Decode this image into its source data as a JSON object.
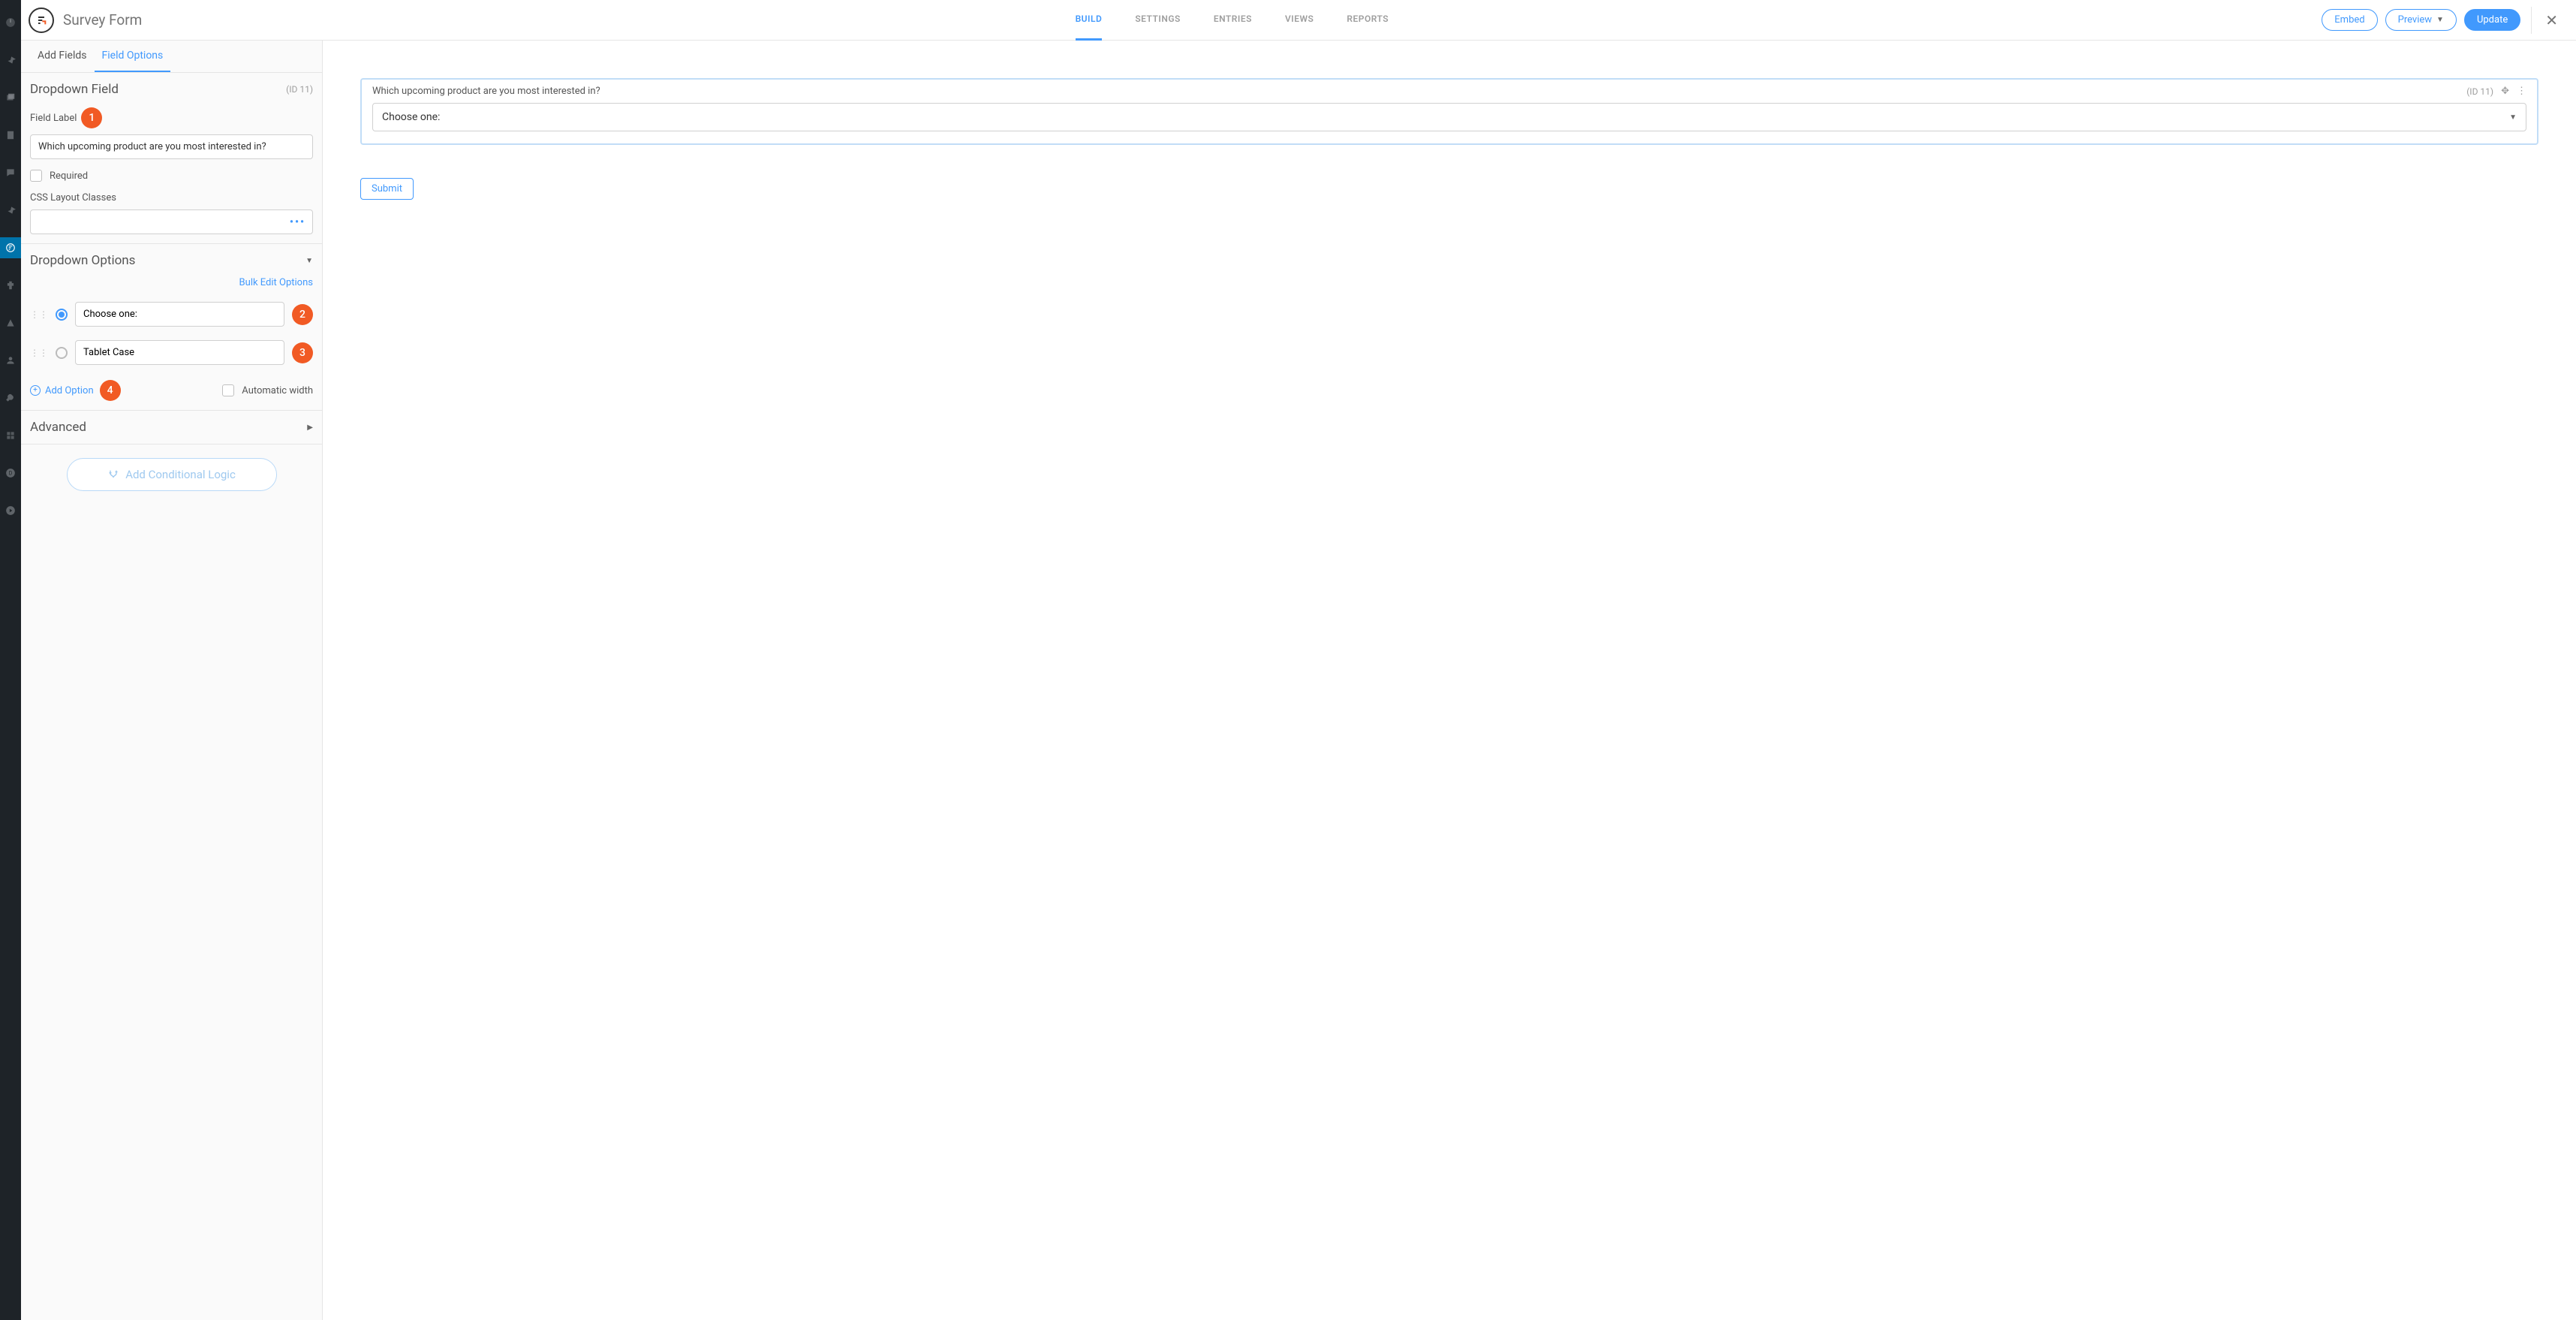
{
  "header": {
    "form_title": "Survey Form",
    "tabs": [
      "BUILD",
      "SETTINGS",
      "ENTRIES",
      "VIEWS",
      "REPORTS"
    ],
    "embed": "Embed",
    "preview": "Preview",
    "update": "Update"
  },
  "panel": {
    "tabs": {
      "add_fields": "Add Fields",
      "field_options": "Field Options"
    },
    "field_type": "Dropdown Field",
    "field_id": "(ID 11)",
    "field_label_label": "Field Label",
    "field_label_value": "Which upcoming product are you most interested in?",
    "required_label": "Required",
    "css_classes_label": "CSS Layout Classes",
    "css_classes_value": "",
    "dropdown_options_title": "Dropdown Options",
    "bulk_edit": "Bulk Edit Options",
    "options": [
      {
        "value": "Choose one:",
        "selected": true
      },
      {
        "value": "Tablet Case",
        "selected": false
      }
    ],
    "add_option": "Add Option",
    "automatic_width": "Automatic width",
    "advanced": "Advanced",
    "conditional_logic": "Add Conditional Logic"
  },
  "annotations": {
    "b1": "1",
    "b2": "2",
    "b3": "3",
    "b4": "4"
  },
  "canvas": {
    "question": "Which upcoming product are you most interested in?",
    "field_id": "(ID 11)",
    "placeholder": "Choose one:",
    "submit": "Submit"
  }
}
